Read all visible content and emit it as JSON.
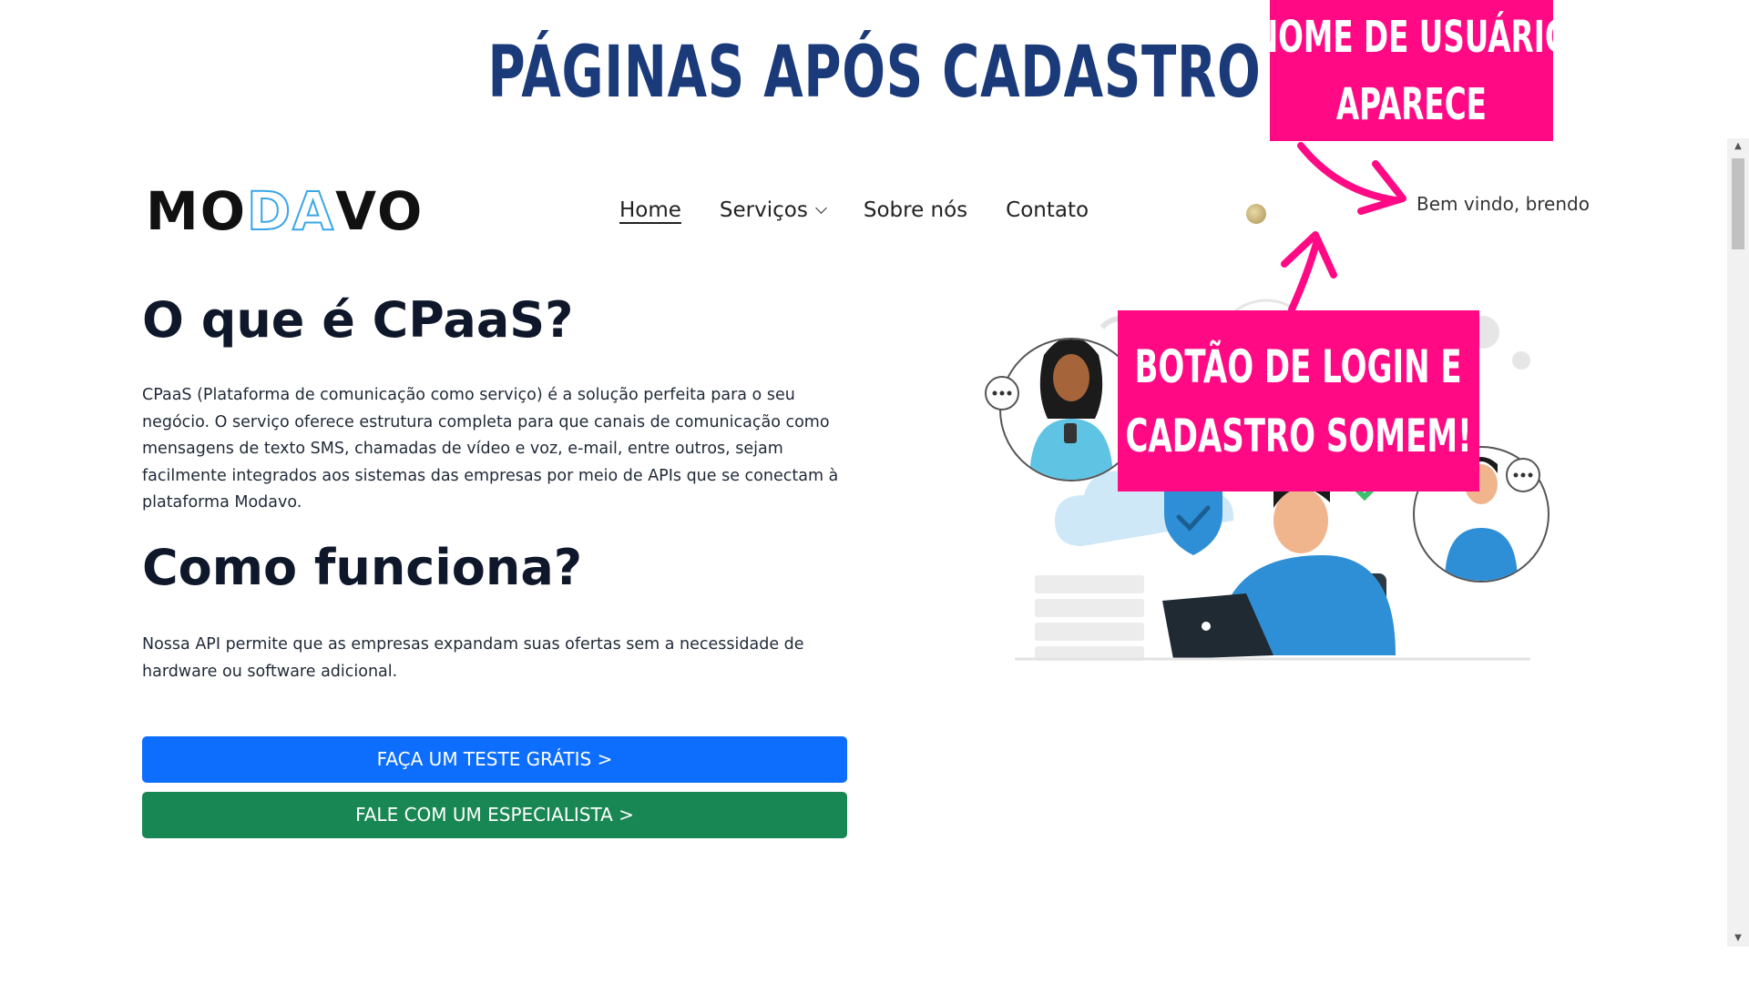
{
  "slide": {
    "title": "PÁGINAS APÓS CADASTRO"
  },
  "callouts": {
    "username": {
      "line1": "NOME DE USUÁRIO",
      "line2": "APARECE"
    },
    "login": {
      "line1": "BOTÃO DE LOGIN E",
      "line2": "CADASTRO SOMEM!"
    }
  },
  "navbar": {
    "logo": {
      "part1": "MO",
      "part2": "DA",
      "part3": "VO"
    },
    "items": [
      {
        "label": "Home"
      },
      {
        "label": "Serviços"
      },
      {
        "label": "Sobre nós"
      },
      {
        "label": "Contato"
      }
    ],
    "welcome": "Bem vindo, brendo"
  },
  "content": {
    "cpaas_title": "O que é CPaaS?",
    "cpaas_text": "CPaaS (Plataforma de comunicação como serviço) é a solução perfeita para o seu negócio. O serviço oferece estrutura completa para que canais de comunicação como mensagens de texto SMS, chamadas de vídeo e voz, e-mail, entre outros, sejam facilmente integrados aos sistemas das empresas por meio de APIs que se conectam à plataforma Modavo.",
    "como_title": "Como funciona?",
    "como_text": "Nossa API permite que as empresas expandam suas ofertas sem a necessidade de hardware ou software adicional.",
    "cta_trial": "FAÇA UM TESTE GRÁTIS >",
    "cta_specialist": "FALE COM UM ESPECIALISTA >"
  },
  "colors": {
    "title": "#1a3a7a",
    "callout": "#ff0a84",
    "primary_button": "#0d6efd",
    "success_button": "#198754",
    "illustration_accent": "#2e8fd6"
  },
  "icons": {
    "chevron": "chevron-down-icon",
    "avatar": "user-avatar-icon",
    "chat": "chat-bubble-icon",
    "shield": "shield-check-icon",
    "gear": "gear-icon"
  }
}
